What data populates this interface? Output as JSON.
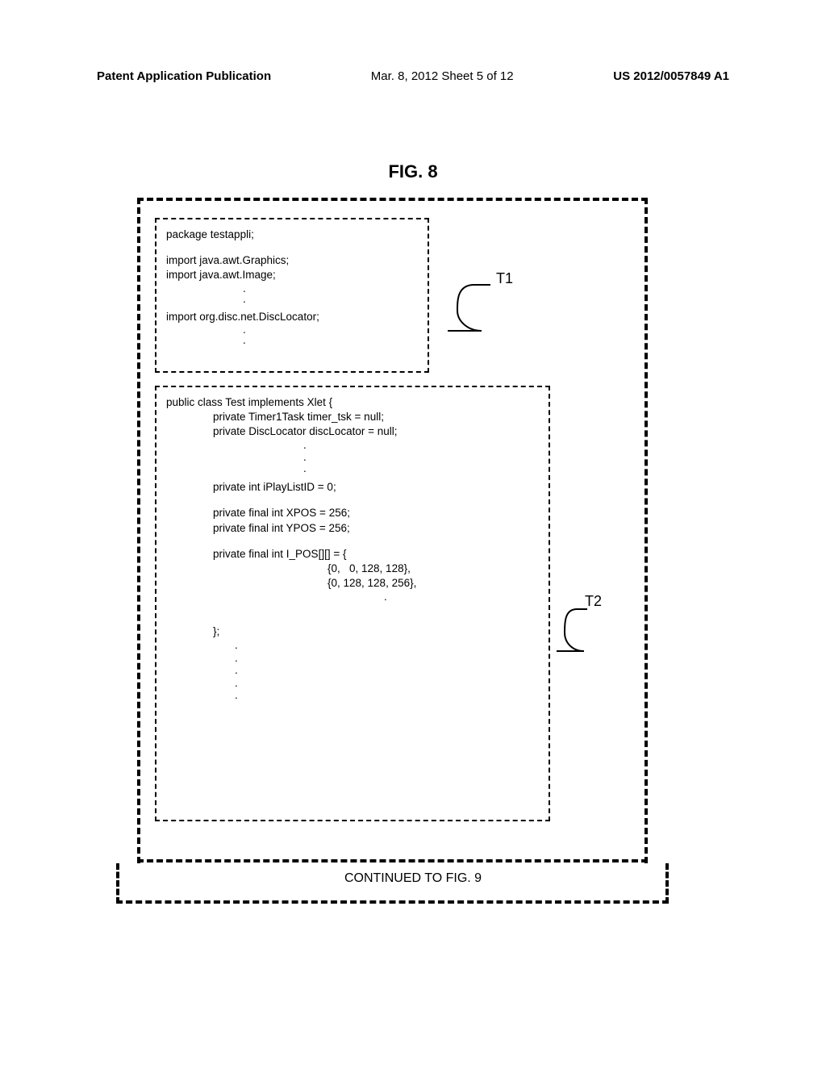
{
  "header": {
    "left": "Patent Application Publication",
    "center": "Mar. 8, 2012  Sheet 5 of 12",
    "right": "US 2012/0057849 A1"
  },
  "figure": {
    "title": "FIG. 8",
    "continued": "CONTINUED TO FIG. 9",
    "label_t1": "T1",
    "label_t2": "T2"
  },
  "t1": {
    "l1": "package testappli;",
    "l2": "import java.awt.Graphics;",
    "l3": "import java.awt.Image;",
    "l4": "import org.disc.net.DiscLocator;"
  },
  "t2": {
    "l1": "public class Test implements Xlet {",
    "l2": "private Timer1Task timer_tsk = null;",
    "l3": "private DiscLocator discLocator = null;",
    "l4": "private int iPlayListID = 0;",
    "l5": "private final int XPOS = 256;",
    "l6": "private final int YPOS = 256;",
    "l7": "private final int I_POS[][] = {",
    "l8": "{0,   0, 128, 128},",
    "l9": "{0, 128, 128, 256},",
    "l10": "};"
  },
  "dots": {
    "d": "."
  }
}
